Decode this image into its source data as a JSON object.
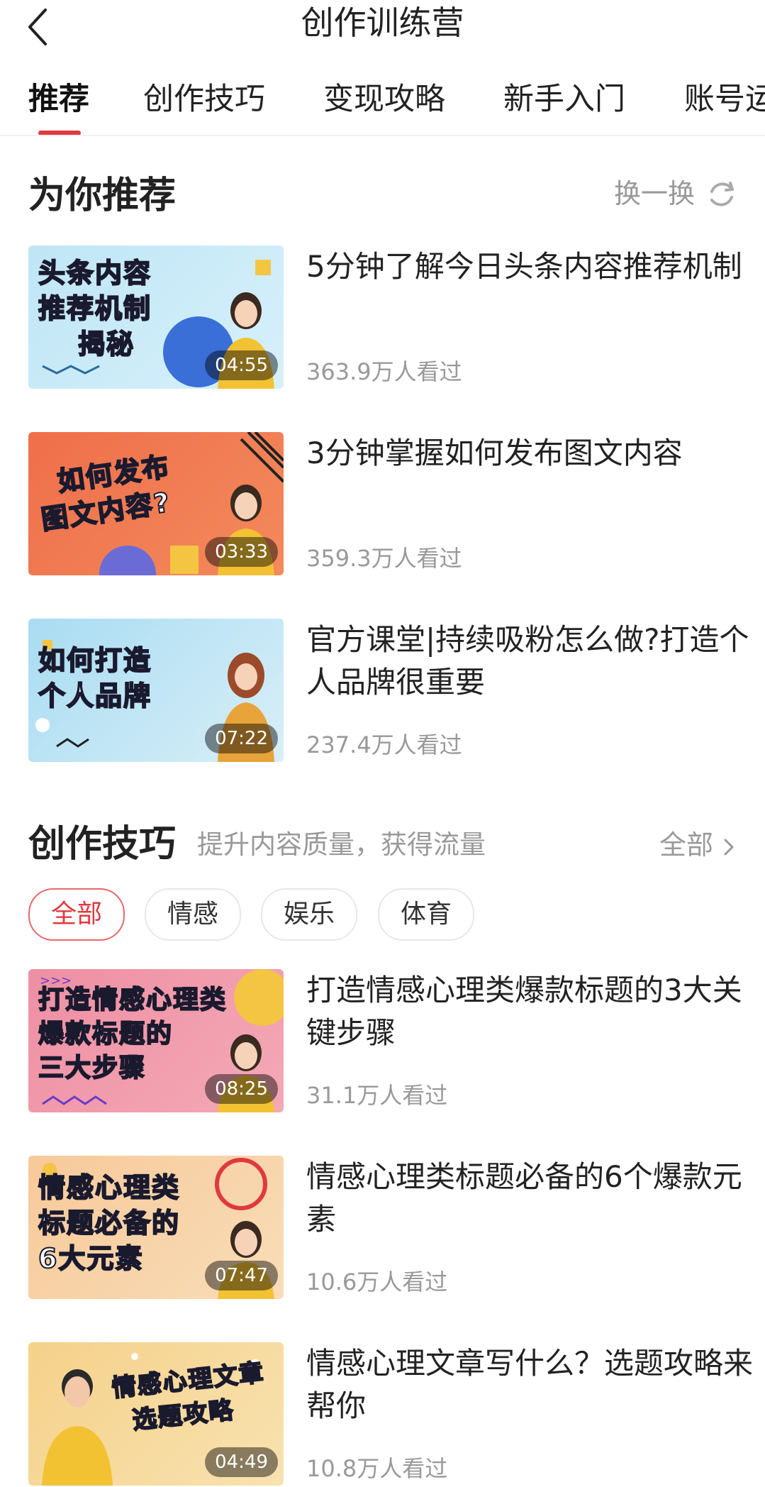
{
  "header": {
    "title": "创作训练营"
  },
  "tabs": [
    {
      "label": "推荐",
      "active": true
    },
    {
      "label": "创作技巧",
      "active": false
    },
    {
      "label": "变现攻略",
      "active": false
    },
    {
      "label": "新手入门",
      "active": false
    },
    {
      "label": "账号运",
      "active": false
    }
  ],
  "recommend": {
    "title": "为你推荐",
    "refresh_label": "换一换",
    "items": [
      {
        "thumb_text": [
          "头条内容",
          "推荐机制",
          "揭秘"
        ],
        "duration": "04:55",
        "title": "5分钟了解今日头条内容推荐机制",
        "views": "363.9万人看过"
      },
      {
        "thumb_text": [
          "如何发布",
          "图文内容?"
        ],
        "duration": "03:33",
        "title": "3分钟掌握如何发布图文内容",
        "views": "359.3万人看过"
      },
      {
        "thumb_text": [
          "如何打造",
          "个人品牌"
        ],
        "duration": "07:22",
        "title": "官方课堂|持续吸粉怎么做?打造个人品牌很重要",
        "views": "237.4万人看过"
      }
    ]
  },
  "skills": {
    "title": "创作技巧",
    "subtitle": "提升内容质量，获得流量",
    "all_label": "全部",
    "chips": [
      {
        "label": "全部",
        "active": true
      },
      {
        "label": "情感",
        "active": false
      },
      {
        "label": "娱乐",
        "active": false
      },
      {
        "label": "体育",
        "active": false
      }
    ],
    "items": [
      {
        "thumb_text": [
          "打造情感心理类",
          "爆款标题的",
          "三大步骤"
        ],
        "duration": "08:25",
        "title": "打造情感心理类爆款标题的3大关键步骤",
        "views": "31.1万人看过"
      },
      {
        "thumb_text": [
          "情感心理类",
          "标题必备的",
          "6大元素"
        ],
        "duration": "07:47",
        "title": "情感心理类标题必备的6个爆款元素",
        "views": "10.6万人看过"
      },
      {
        "thumb_text": [
          "情感心理文章",
          "选题攻略"
        ],
        "duration": "04:49",
        "title": "情感心理文章写什么？选题攻略来帮你",
        "views": "10.8万人看过"
      }
    ]
  },
  "colors": {
    "accent": "#e0393e",
    "muted": "#999999"
  }
}
